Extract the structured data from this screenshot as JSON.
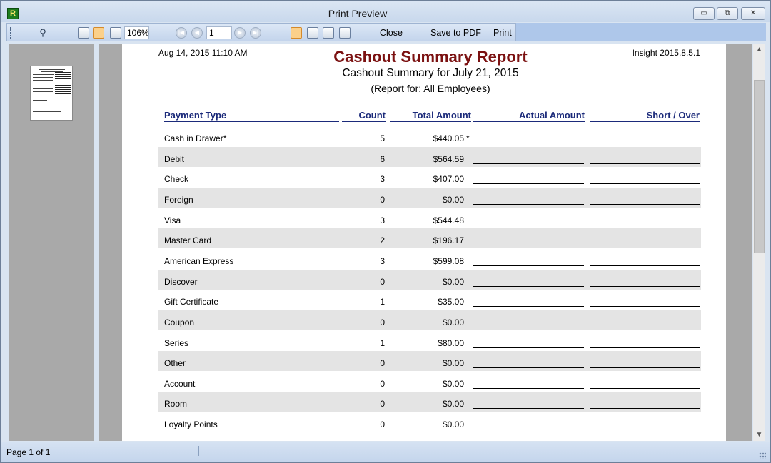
{
  "window": {
    "title": "Print Preview",
    "app_icon_letter": "R",
    "minimize_glyph": "▭",
    "restore_glyph": "⧉",
    "close_glyph": "✕"
  },
  "toolbar": {
    "zoom": "106%",
    "page_number": "1",
    "close_label": "Close",
    "save_pdf_label": "Save to PDF",
    "print_label": "Print"
  },
  "report": {
    "date": "Aug 14, 2015 11:10 AM",
    "title": "Cashout Summary Report",
    "version": "Insight 2015.8.5.1",
    "subtitle": "Cashout Summary for July 21, 2015",
    "report_for": "(Report for: All Employees)",
    "headers": {
      "type": "Payment Type",
      "count": "Count",
      "total": "Total Amount",
      "actual": "Actual Amount",
      "short_over": "Short / Over"
    },
    "rows": [
      {
        "type": "Cash in Drawer*",
        "count": "5",
        "total": "$440.05",
        "mark": "*"
      },
      {
        "type": "Debit",
        "count": "6",
        "total": "$564.59",
        "mark": ""
      },
      {
        "type": "Check",
        "count": "3",
        "total": "$407.00",
        "mark": ""
      },
      {
        "type": "Foreign",
        "count": "0",
        "total": "$0.00",
        "mark": ""
      },
      {
        "type": "Visa",
        "count": "3",
        "total": "$544.48",
        "mark": ""
      },
      {
        "type": "Master Card",
        "count": "2",
        "total": "$196.17",
        "mark": ""
      },
      {
        "type": "American Express",
        "count": "3",
        "total": "$599.08",
        "mark": ""
      },
      {
        "type": "Discover",
        "count": "0",
        "total": "$0.00",
        "mark": ""
      },
      {
        "type": "Gift Certificate",
        "count": "1",
        "total": "$35.00",
        "mark": ""
      },
      {
        "type": "Coupon",
        "count": "0",
        "total": "$0.00",
        "mark": ""
      },
      {
        "type": "Series",
        "count": "1",
        "total": "$80.00",
        "mark": ""
      },
      {
        "type": "Other",
        "count": "0",
        "total": "$0.00",
        "mark": ""
      },
      {
        "type": "Account",
        "count": "0",
        "total": "$0.00",
        "mark": ""
      },
      {
        "type": "Room",
        "count": "0",
        "total": "$0.00",
        "mark": ""
      },
      {
        "type": "Loyalty Points",
        "count": "0",
        "total": "$0.00",
        "mark": ""
      }
    ]
  },
  "status": {
    "page_info": "Page 1 of 1"
  }
}
